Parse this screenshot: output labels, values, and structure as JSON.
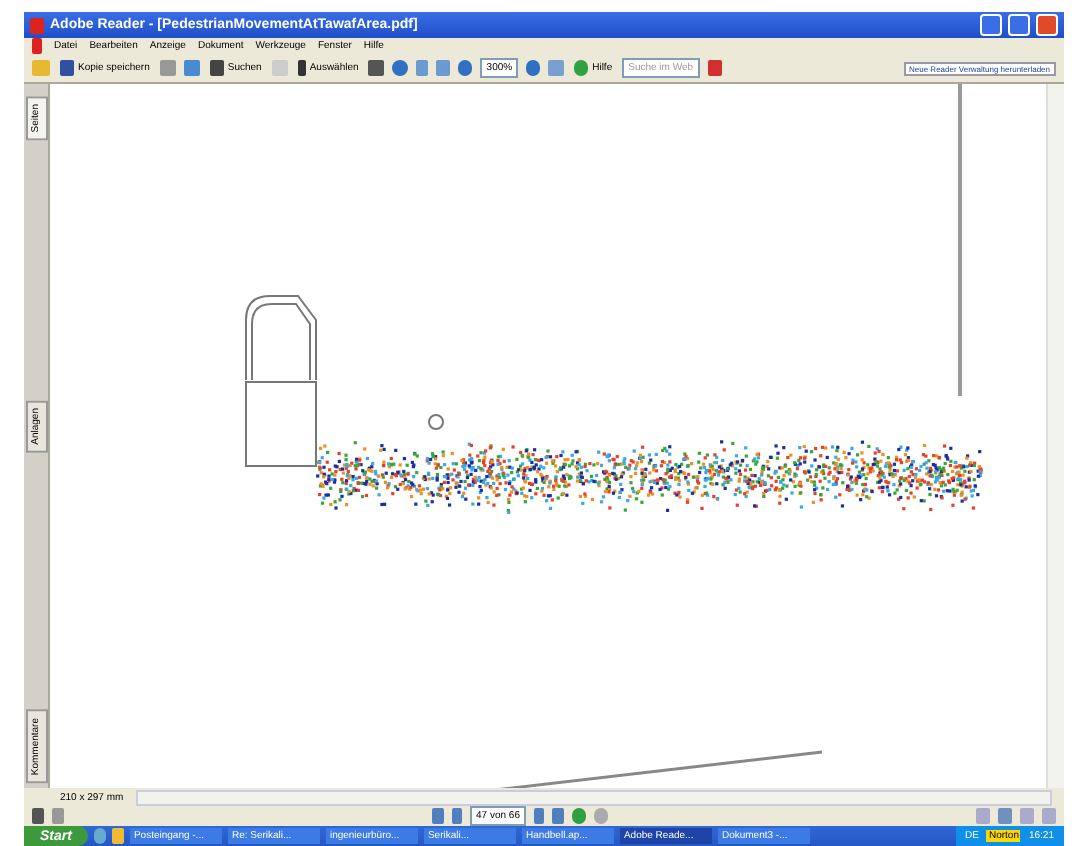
{
  "window": {
    "title": "Adobe Reader - [PedestrianMovementAtTawafArea.pdf]"
  },
  "menu": [
    "Datei",
    "Bearbeiten",
    "Anzeige",
    "Dokument",
    "Werkzeuge",
    "Fenster",
    "Hilfe"
  ],
  "toolbar": {
    "save_copy": "Kopie speichern",
    "search": "Suchen",
    "select": "Auswählen",
    "zoom": "300%",
    "help": "Hilfe",
    "web_search": {
      "placeholder": "Suche im Web"
    },
    "promo": "Neue Reader Verwaltung herunterladen"
  },
  "side_tabs": [
    {
      "label": "Seiten",
      "selected": true
    },
    {
      "label": "Anlagen",
      "selected": false
    },
    {
      "label": "Kommentare",
      "selected": false
    }
  ],
  "status_bar": {
    "page_size": "210 x 297 mm"
  },
  "navigation": {
    "page": "47 von 66"
  },
  "taskbar": {
    "start": "Start",
    "tasks": [
      {
        "label": "Posteingang -...",
        "selected": false
      },
      {
        "label": "Re: Serikali...",
        "selected": false
      },
      {
        "label": "ingenieurbüro...",
        "selected": false
      },
      {
        "label": "Serikali...",
        "selected": false
      },
      {
        "label": "Handbell.ap...",
        "selected": false
      },
      {
        "label": "Adobe Reade...",
        "selected": true
      },
      {
        "label": "Dokument3 -...",
        "selected": false
      }
    ],
    "language": "DE",
    "norton": "Norton",
    "clock": "16:21"
  }
}
